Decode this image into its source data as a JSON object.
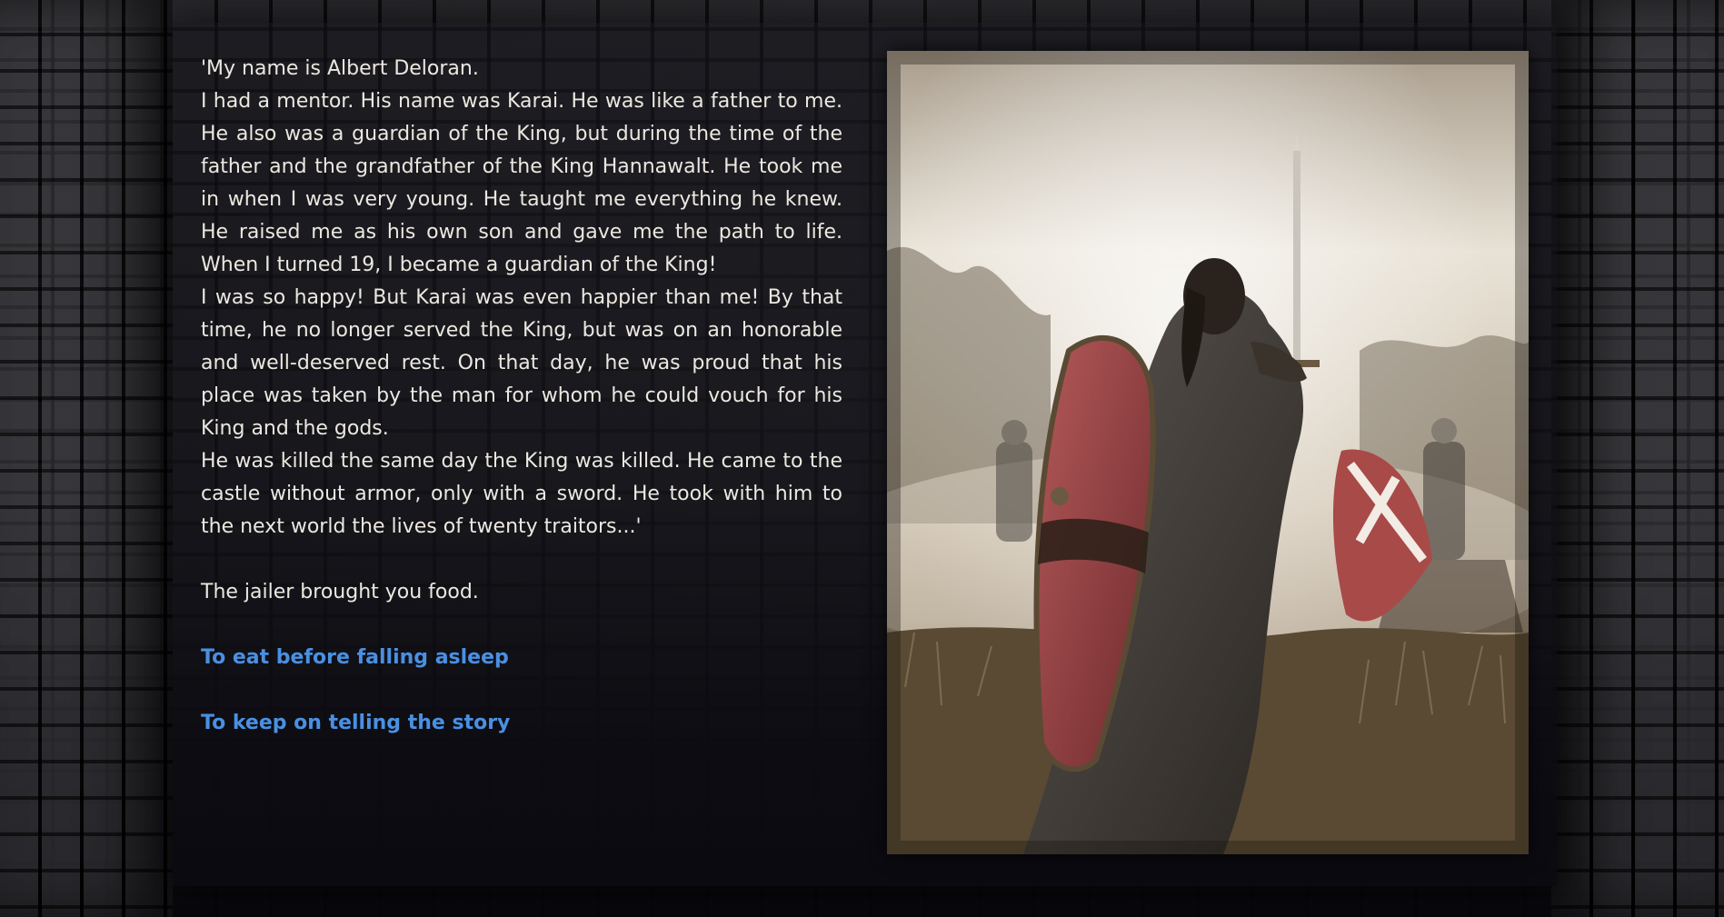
{
  "story": {
    "paragraphs": [
      "'My name is Albert Deloran.",
      "I had a mentor. His name was Karai. He was like a father to me. He also was a guardian of the King, but during the time of the father and the grandfather of the King Hannawalt. He took me in when I was very young. He taught me everything he knew. He raised me as his own son and gave me the path to life. When I turned 19, I became a guardian of the King!",
      "I was so happy! But Karai was even happier than me! By that time, he no longer served the King, but was on an honorable and well-deserved rest. On that day, he was proud that his place was taken by the man for whom he could vouch for his King and the gods.",
      "He was killed the same day the King was killed. He came to the castle without armor, only with a sword. He took with him to the next world the lives of twenty traitors...'"
    ],
    "narration": "The jailer brought you food."
  },
  "choices": [
    {
      "label": "To eat before falling asleep"
    },
    {
      "label": "To keep on telling the story"
    }
  ],
  "colors": {
    "text": "#ece8e0",
    "choice": "#4a90e2",
    "background": "#0a0a0e"
  },
  "illustration": {
    "subject": "knight-with-sword-and-shield-illustration"
  }
}
